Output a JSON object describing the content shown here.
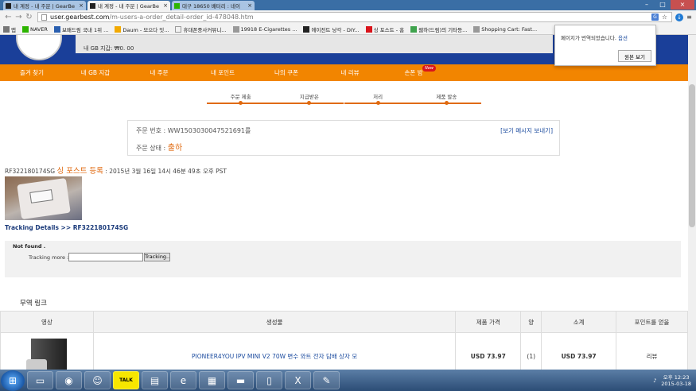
{
  "browser": {
    "tabs": [
      {
        "title": "내 계정 - 내 주문 | GearBe",
        "active": false
      },
      {
        "title": "내 계정 - 내 주문 | GearBe",
        "active": true
      },
      {
        "title": "대구 18650 배터리 : 네이",
        "active": false
      }
    ],
    "url_host": "user.gearbest.com",
    "url_path": "/m-users-a-order_detail-order_id-478048.htm",
    "bookmarks": [
      "앱",
      "NAVER",
      "보배드림 국내 1위 ...",
      "Daum - 모으다 잇...",
      "휴대폰중사커뮤니...",
      "19918 E-Cigarettes ...",
      "에이전트 낭각 - DIY...",
      "싱 포스트 - 홈",
      "웹하(드림)의 기타등...",
      "Shopping Cart: Fast..."
    ]
  },
  "translate_popup": {
    "message": "페이지가 번역되었습니다.",
    "options_link": "옵션",
    "show_original_button": "원본 보기"
  },
  "header": {
    "gb_balance": "내 GB 지갑: ₩0. 00"
  },
  "nav": {
    "items": [
      "즐겨 찾기",
      "내 GB 지갑",
      "내 주문",
      "내 포인트",
      "나의 쿠폰",
      "내 리뷰",
      "손폰 밤"
    ],
    "new_badge": "New"
  },
  "progress": {
    "steps": [
      "주문 제출",
      "지급받은",
      "처리",
      "제품 발송"
    ]
  },
  "order": {
    "number_label": "주문 번호 : ",
    "number_value": "WW1503030047521691를",
    "message_link": "[보기 메시지 보내기]",
    "status_label": "주문 상태 : ",
    "status_value": "출하"
  },
  "tracking": {
    "code": "RF322180174SG",
    "carrier": "싱 포스트 등록",
    "timestamp": ": 2015년 3월 16일 14시 46분 49초 오후 PST",
    "details_link": "Tracking Details >> RF322180174SG",
    "not_found": "Not found .",
    "more_label": "Tracking more :",
    "input_value": "",
    "button": "Tracking.."
  },
  "products": {
    "section_title": "무역 링크",
    "headers": [
      "영상",
      "생성물",
      "제품 가격",
      "양",
      "소계",
      "포인트를 얻을"
    ],
    "rows": [
      {
        "name": "PIONEER4YOU IPV MINI V2 70W 변수 와트 전자 담배 상자 모",
        "price": "USD 73.97",
        "qty": "(1)",
        "subtotal": "USD 73.97",
        "points": "리뷰"
      }
    ]
  },
  "taskbar": {
    "time": "오후 12:23",
    "date": "2015-03-18",
    "talk_label": "TALK"
  },
  "colors": {
    "nav_orange": "#f28500",
    "header_blue": "#1a3f99",
    "accent": "#e06a10",
    "link_blue": "#1a4a9e"
  }
}
